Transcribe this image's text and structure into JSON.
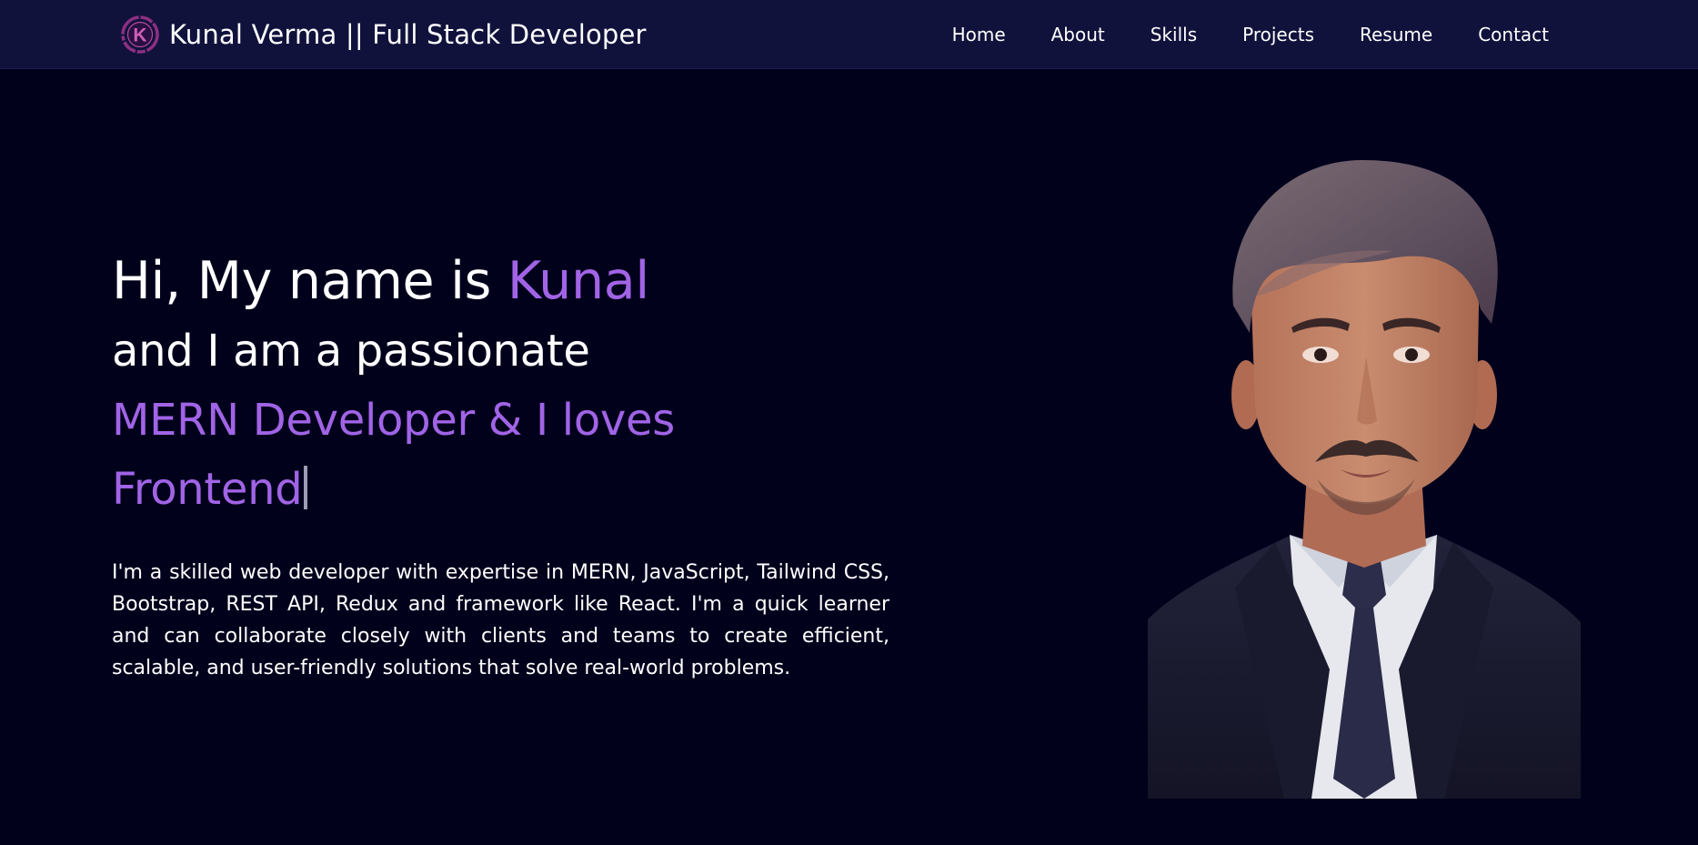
{
  "header": {
    "logo_letter": "K",
    "brand_title": "Kunal Verma || Full Stack Developer",
    "nav": [
      {
        "label": "Home"
      },
      {
        "label": "About"
      },
      {
        "label": "Skills"
      },
      {
        "label": "Projects"
      },
      {
        "label": "Resume"
      },
      {
        "label": "Contact"
      }
    ]
  },
  "hero": {
    "greeting_prefix": "Hi, My name is ",
    "name": "Kunal",
    "intro": "and I am a passionate",
    "typed_text": "MERN Developer & I loves Frontend",
    "description": "I'm a skilled web developer with expertise in MERN, JavaScript, Tailwind CSS, Bootstrap, REST API, Redux and framework like React. I'm a quick learner and can collaborate closely with clients and teams to create efficient, scalable, and user-friendly solutions that solve real-world problems."
  },
  "colors": {
    "page_background": "#02011c",
    "navbar_background": "#11123c",
    "accent": "#a164e6",
    "text": "#ffffff"
  },
  "icons": {
    "logo": "k-circle-logo",
    "profile": "profile-portrait"
  }
}
